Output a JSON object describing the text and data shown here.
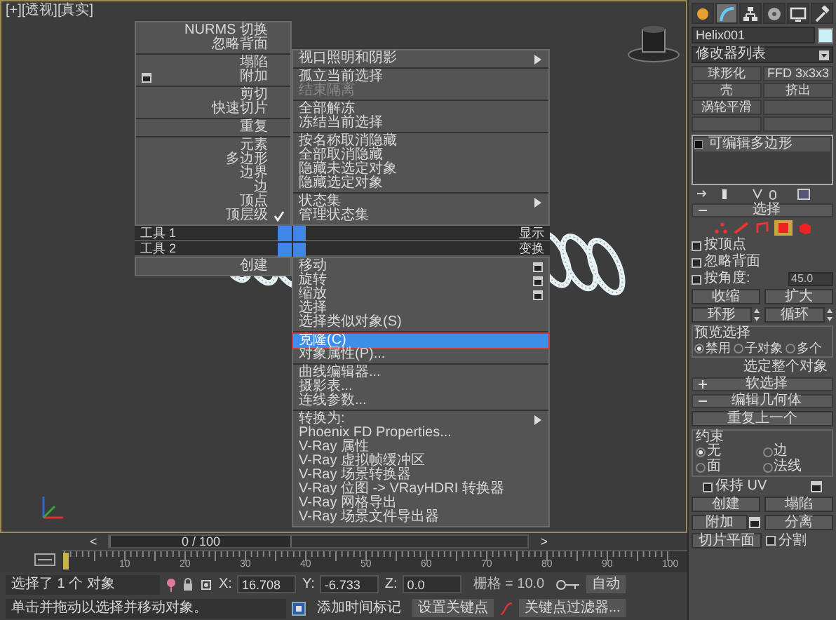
{
  "viewport": {
    "label": "[+][透视][真实]"
  },
  "quad_menu": {
    "top_left": [
      [
        {
          "label": "NURMS 切换",
          "options": false,
          "checked": false
        },
        {
          "label": "忽略背面",
          "options": false,
          "checked": false
        }
      ],
      [
        {
          "label": "塌陷",
          "options": false,
          "checked": false
        },
        {
          "label": "附加",
          "options": true,
          "checked": false
        }
      ],
      [
        {
          "label": "剪切",
          "options": false,
          "checked": false
        },
        {
          "label": "快速切片",
          "options": false,
          "checked": false
        }
      ],
      [
        {
          "label": "重复",
          "options": false,
          "checked": false
        }
      ],
      [
        {
          "label": "元素",
          "options": false,
          "checked": false
        },
        {
          "label": "多边形",
          "options": false,
          "checked": false
        },
        {
          "label": "边界",
          "options": false,
          "checked": false
        },
        {
          "label": "边",
          "options": false,
          "checked": false
        },
        {
          "label": "顶点",
          "options": false,
          "checked": false
        },
        {
          "label": "顶层级",
          "options": false,
          "checked": true
        }
      ]
    ],
    "top_right": [
      [
        {
          "label": "视口照明和阴影",
          "submenu": true,
          "disabled": false
        }
      ],
      [
        {
          "label": "孤立当前选择",
          "submenu": false,
          "disabled": false
        },
        {
          "label": "结束隔离",
          "submenu": false,
          "disabled": true
        }
      ],
      [
        {
          "label": "全部解冻",
          "submenu": false,
          "disabled": false
        },
        {
          "label": "冻结当前选择",
          "submenu": false,
          "disabled": false
        }
      ],
      [
        {
          "label": "按名称取消隐藏",
          "submenu": false,
          "disabled": false
        },
        {
          "label": "全部取消隐藏",
          "submenu": false,
          "disabled": false
        },
        {
          "label": "隐藏未选定对象",
          "submenu": false,
          "disabled": false
        },
        {
          "label": "隐藏选定对象",
          "submenu": false,
          "disabled": false
        }
      ],
      [
        {
          "label": "状态集",
          "submenu": true,
          "disabled": false
        },
        {
          "label": "管理状态集",
          "submenu": false,
          "disabled": false
        }
      ]
    ],
    "quadrant_labels": [
      {
        "left": "工具 1",
        "right": "显示"
      },
      {
        "left": "工具 2",
        "right": "变换"
      }
    ],
    "bottom_left": [
      [
        {
          "label": "创建"
        }
      ]
    ],
    "bottom_right": [
      [
        {
          "label": "移动",
          "options": true,
          "submenu": false,
          "selected": false
        },
        {
          "label": "旋转",
          "options": true,
          "submenu": false,
          "selected": false
        },
        {
          "label": "缩放",
          "options": true,
          "submenu": false,
          "selected": false
        },
        {
          "label": "选择",
          "options": false,
          "submenu": false,
          "selected": false
        },
        {
          "label": "选择类似对象(S)",
          "options": false,
          "submenu": false,
          "selected": false
        }
      ],
      [
        {
          "label": "克隆(C)",
          "options": false,
          "submenu": false,
          "selected": true
        },
        {
          "label": "对象属性(P)...",
          "options": false,
          "submenu": false,
          "selected": false
        }
      ],
      [
        {
          "label": "曲线编辑器...",
          "options": false,
          "submenu": false,
          "selected": false
        },
        {
          "label": "摄影表...",
          "options": false,
          "submenu": false,
          "selected": false
        },
        {
          "label": "连线参数...",
          "options": false,
          "submenu": false,
          "selected": false
        }
      ],
      [
        {
          "label": "转换为:",
          "options": false,
          "submenu": true,
          "selected": false
        },
        {
          "label": "Phoenix FD Properties...",
          "options": false,
          "submenu": false,
          "selected": false
        },
        {
          "label": "V-Ray 属性",
          "options": false,
          "submenu": false,
          "selected": false
        },
        {
          "label": "V-Ray 虚拟帧缓冲区",
          "options": false,
          "submenu": false,
          "selected": false
        },
        {
          "label": "V-Ray 场景转换器",
          "options": false,
          "submenu": false,
          "selected": false
        },
        {
          "label": "V-Ray 位图 -> VRayHDRI 转换器",
          "options": false,
          "submenu": false,
          "selected": false
        },
        {
          "label": "V-Ray 网格导出",
          "options": false,
          "submenu": false,
          "selected": false
        },
        {
          "label": "V-Ray 场景文件导出器",
          "options": false,
          "submenu": false,
          "selected": false
        }
      ]
    ]
  },
  "command_panel": {
    "tabs": [
      {
        "selected": false
      },
      {
        "selected": true
      },
      {
        "selected": false
      },
      {
        "selected": false
      },
      {
        "selected": false
      },
      {
        "selected": false
      }
    ],
    "object_name": "Helix001",
    "modifier_list": "修改器列表",
    "modifier_buttons": [
      "球形化",
      "FFD 3x3x3",
      "壳",
      "挤出",
      "涡轮平滑"
    ],
    "stack": [
      {
        "label": "可编辑多边形"
      }
    ],
    "selection": {
      "title": "选择",
      "expanded": true,
      "levels": [
        {
          "selected": false
        },
        {
          "selected": false
        },
        {
          "selected": false
        },
        {
          "selected": true
        },
        {
          "selected": false
        }
      ],
      "checkboxes": [
        {
          "label": "按顶点",
          "checked": false
        },
        {
          "label": "忽略背面",
          "checked": false
        },
        {
          "label": "按角度:",
          "checked": false,
          "value": "45.0"
        }
      ],
      "buttons": [
        {
          "label": "收缩",
          "spinner": false
        },
        {
          "label": "扩大",
          "spinner": false
        },
        {
          "label": "环形",
          "spinner": true
        },
        {
          "label": "循环",
          "spinner": true
        }
      ],
      "preview": {
        "title": "预览选择",
        "options": [
          {
            "label": "禁用",
            "selected": true
          },
          {
            "label": "子对象",
            "selected": false
          },
          {
            "label": "多个",
            "selected": false
          }
        ]
      },
      "whole_object": "选定整个对象"
    },
    "rollouts": [
      {
        "title": "软选择",
        "expanded": false
      },
      {
        "title": "编辑几何体",
        "expanded": true
      }
    ],
    "edit_geometry": {
      "repeat_last": "重复上一个",
      "constraints": {
        "title": "约束",
        "options": [
          {
            "label": "无",
            "selected": true
          },
          {
            "label": "边",
            "selected": false
          },
          {
            "label": "面",
            "selected": false
          },
          {
            "label": "法线",
            "selected": false
          }
        ]
      },
      "preserve_uv": {
        "label": "保持 UV",
        "checked": false
      },
      "buttons": [
        {
          "label": "创建",
          "options": false
        },
        {
          "label": "塌陷",
          "options": false
        },
        {
          "label": "附加",
          "options": true
        },
        {
          "label": "分离",
          "options": false
        }
      ],
      "slice_plane": "切片平面",
      "split": {
        "label": "分割",
        "checked": false
      }
    }
  },
  "timeline": {
    "slider": "0 / 100",
    "level": 0,
    "prev": "<",
    "next": ">",
    "ticks": [
      "10",
      "20",
      "30",
      "40",
      "50",
      "60",
      "70",
      "80",
      "90",
      "100"
    ]
  },
  "status_bar": {
    "selection": "选择了 1 个 对象",
    "prompt": "单击并拖动以选择并移动对象。",
    "coords": [
      {
        "label": "X:",
        "value": "16.708"
      },
      {
        "label": "Y:",
        "value": "-6.733"
      },
      {
        "label": "Z:",
        "value": "0.0"
      }
    ],
    "grid": "栅格 = 10.0",
    "auto_key": "自动",
    "add_time_tag": "添加时间标记",
    "set_key": "设置关键点",
    "key_filters": "关键点过滤器..."
  }
}
